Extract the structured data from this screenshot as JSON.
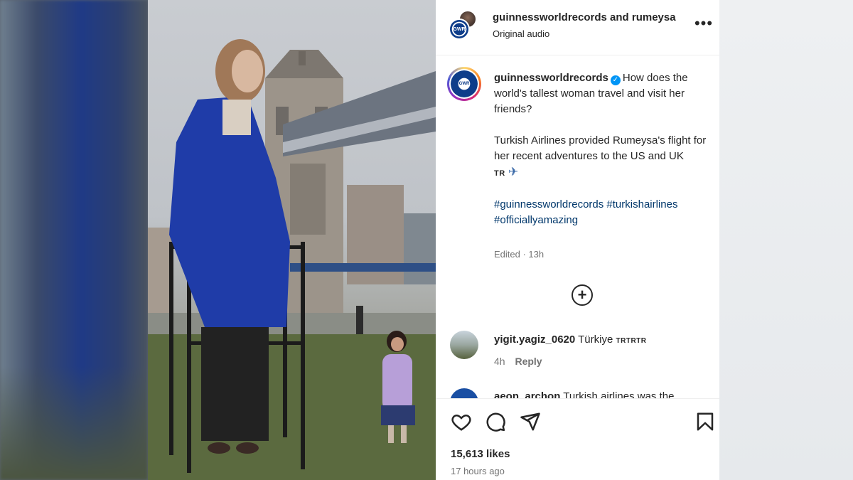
{
  "post": {
    "header_title": "guinnessworldrecords and rumeysa",
    "header_subtitle": "Original audio",
    "more_label": "•••"
  },
  "caption": {
    "username": "guinnessworldrecords",
    "line1": "How does the world's tallest woman travel and visit her friends?",
    "line2": "Turkish Airlines provided Rumeysa's flight for her recent adventures to the US and UK",
    "flag_text": "TR",
    "hashtags": "#guinnessworldrecords #turkishairlines #officiallyamazing",
    "edited": "Edited · 13h"
  },
  "load_more": "+",
  "comments": [
    {
      "username": "yigit.yagiz_0620",
      "text": "Türkiye",
      "flags": "TRTRTR",
      "time": "4h",
      "reply": "Reply"
    },
    {
      "username": "aeon_archon",
      "text": "Turkish airlines was the"
    }
  ],
  "footer": {
    "likes": "15,613 likes",
    "time": "17 hours ago"
  },
  "icons": [
    "more-icon",
    "verified-icon",
    "plane-icon",
    "plus-circle-icon",
    "heart-icon",
    "comment-icon",
    "share-icon",
    "bookmark-icon"
  ],
  "colors": {
    "link": "#00376b",
    "verified": "#0095f6",
    "muted": "#737373"
  }
}
